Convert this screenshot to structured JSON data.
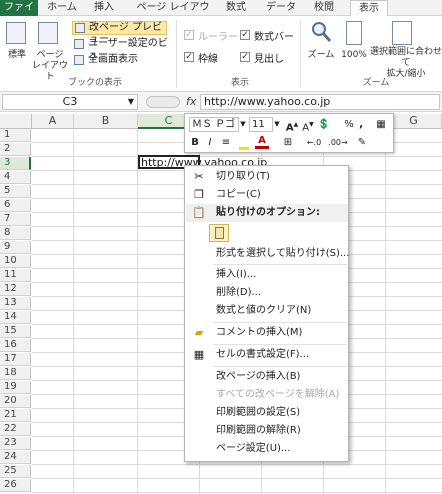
{
  "menu": {
    "tabs": [
      "ファイル",
      "ホーム",
      "挿入",
      "ページ レイアウト",
      "数式",
      "データ",
      "校閲",
      "表示"
    ],
    "active": "表示"
  },
  "ribbon": {
    "book_views": {
      "normal": "標準",
      "page_layout_line1": "ページ",
      "page_layout_line2": "レイアウト",
      "page_break_preview": "改ページ プレビュー",
      "custom_views": "ユーザー設定のビュー",
      "full_screen": "全画面表示",
      "group_label": "ブックの表示"
    },
    "show": {
      "ruler": "ルーラー",
      "formula_bar": "数式バー",
      "gridlines": "枠線",
      "headings": "見出し",
      "group_label": "表示"
    },
    "zoom": {
      "zoom": "ズーム",
      "hundred_percent": "100%",
      "zoom_to_selection_line1": "選択範囲に合わせて",
      "zoom_to_selection_line2": "拡大/縮小",
      "group_label": "ズーム"
    }
  },
  "formula_bar": {
    "name_box": "C3",
    "fx": "fx",
    "value": "http://www.yahoo.co.jp"
  },
  "grid": {
    "columns": [
      "A",
      "B",
      "C",
      "D",
      "E",
      "F",
      "G"
    ],
    "rows": [
      "1",
      "2",
      "3",
      "4",
      "5",
      "6",
      "7",
      "8",
      "9",
      "10",
      "11",
      "12",
      "13",
      "14",
      "15",
      "16",
      "17",
      "18",
      "19",
      "20",
      "21",
      "22",
      "23",
      "24",
      "25",
      "26"
    ],
    "selected_cell_text": "http://www.yahoo.co.jp"
  },
  "mini_toolbar": {
    "font_name": "ＭＳ Ｐゴ",
    "font_size": "11",
    "bold": "B",
    "italic": "I",
    "percent": "%",
    "comma": ","
  },
  "context_menu": {
    "cut": "切り取り(T)",
    "copy": "コピー(C)",
    "paste_options": "貼り付けのオプション:",
    "paste_special": "形式を選択して貼り付け(S)...",
    "insert": "挿入(I)...",
    "delete": "削除(D)...",
    "clear_contents": "数式と値のクリア(N)",
    "insert_comment": "コメントの挿入(M)",
    "format_cells": "セルの書式設定(F)...",
    "insert_page_break": "改ページの挿入(B)",
    "reset_page_breaks": "すべての改ページを解除(A)",
    "set_print_area": "印刷範囲の設定(S)",
    "clear_print_area": "印刷範囲の解除(R)",
    "page_setup": "ページ設定(U)..."
  },
  "colors": {
    "excel_green": "#217346",
    "highlight_yellow": "#fdf0c3"
  }
}
